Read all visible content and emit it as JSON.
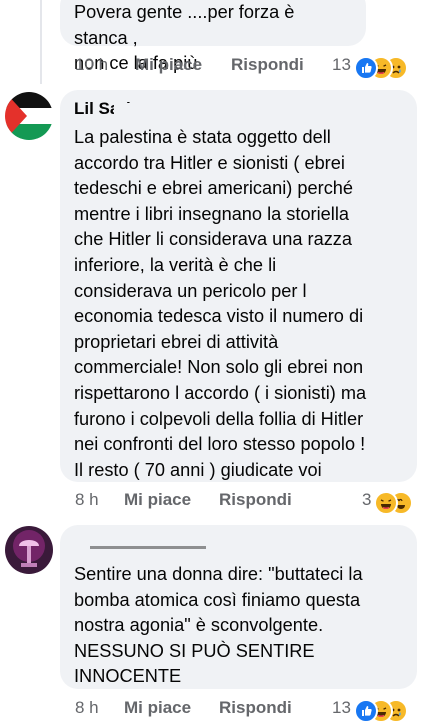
{
  "comments": [
    {
      "author": "",
      "text": "Povera gente ....per forza è stanca ,\nnon ce la fa più",
      "time": "10 h",
      "like": "Mi piace",
      "reply": "Rispondi",
      "reactions": {
        "count": "13",
        "icons": [
          "like-icon",
          "haha-icon",
          "sad-icon"
        ]
      }
    },
    {
      "author": "Lil Sari",
      "avatar": "palestine-flag",
      "text": "La palestina è stata oggetto dell\naccordo tra Hitler e sionisti ( ebrei\ntedeschi e ebrei americani) perché\nmentre i libri insegnano la storiella\nche Hitler li considerava una razza\ninferiore, la verità è che li\nconsiderava un pericolo per l\neconomia tedesca visto il numero di\nproprietari ebrei di attività\ncommerciale! Non solo gli ebrei non\nrispettarono  l accordo ( i sionisti) ma\nfurono i colpevoli della follia di Hitler\nnei confronti del loro stesso popolo !\nIl resto ( 70 anni ) giudicate voi",
      "time": "8 h",
      "like": "Mi piace",
      "reply": "Rispondi",
      "reactions": {
        "count": "3",
        "icons": [
          "haha-icon",
          "love-icon"
        ]
      }
    },
    {
      "author": "",
      "avatar": "lamp-photo",
      "text": "Sentire una donna dire: \"buttateci la\nbomba atomica così finiamo questa\nnostra agonia\" è sconvolgente.\nNESSUNO SI PUÒ SENTIRE\nINNOCENTE",
      "time": "8 h",
      "like": "Mi piace",
      "reply": "Rispondi",
      "reactions": {
        "count": "13",
        "icons": [
          "like-icon",
          "haha-icon",
          "sad-icon"
        ]
      }
    }
  ],
  "colors": {
    "bubble": "#f0f2f5",
    "meta": "#65676b",
    "like": "#1877f2",
    "reaction_yellow": "#f7b928",
    "love": "#f33e58"
  }
}
